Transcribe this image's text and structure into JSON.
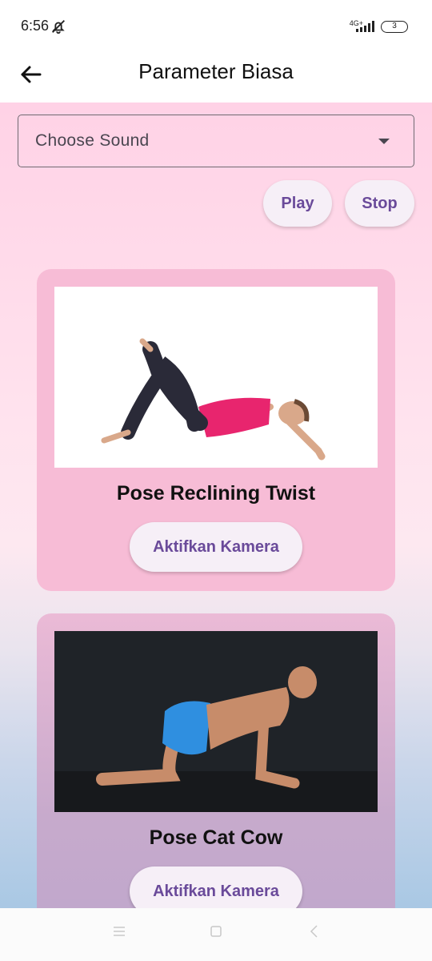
{
  "status_bar": {
    "time": "6:56",
    "network": "4G+",
    "battery": "3",
    "icons": [
      "bell-off-icon",
      "signal-icon",
      "battery-icon"
    ]
  },
  "app_bar": {
    "title": "Parameter Biasa",
    "back_icon": "arrow-left-icon"
  },
  "sound": {
    "dropdown_label": "Choose Sound",
    "play_label": "Play",
    "stop_label": "Stop"
  },
  "poses": [
    {
      "title": "Pose Reclining Twist",
      "button_label": "Aktifkan Kamera",
      "image": "reclining-twist-photo"
    },
    {
      "title": "Pose Cat Cow",
      "button_label": "Aktifkan Kamera",
      "image": "cat-cow-photo"
    }
  ],
  "nav_bar": {
    "icons": [
      "menu-icon",
      "home-icon",
      "back-icon"
    ]
  },
  "colors": {
    "accent": "#6a4a9a",
    "card1": "#f7bcd6",
    "card2": "#c7aacc"
  }
}
